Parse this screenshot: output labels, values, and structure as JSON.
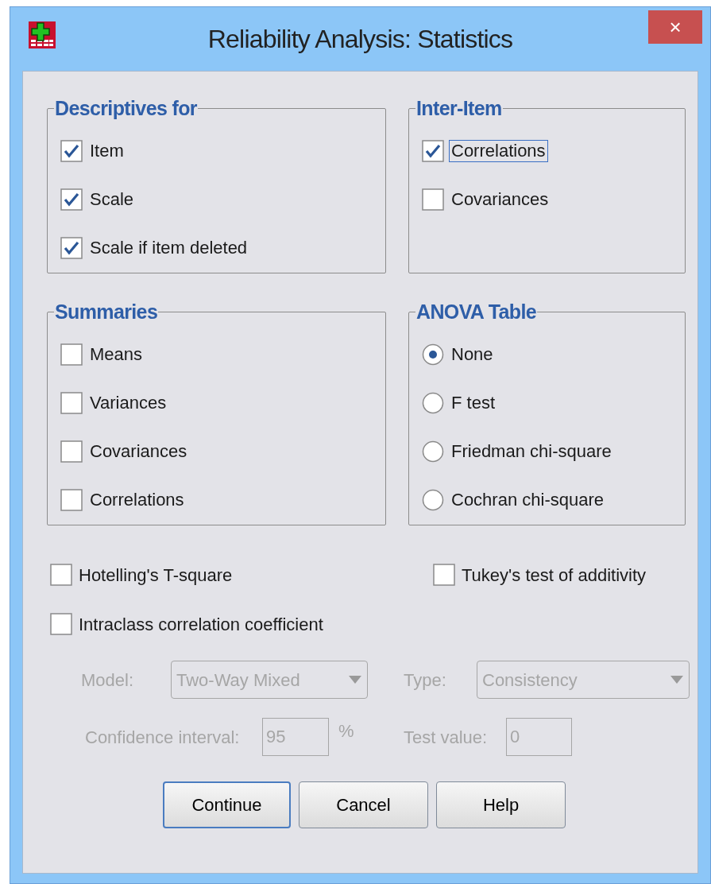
{
  "window": {
    "title": "Reliability Analysis: Statistics",
    "close": "×"
  },
  "groups": [
    {
      "kind": "checks",
      "title": "Descriptives for",
      "items": [
        {
          "label": "Item",
          "checked": true,
          "focused": false
        },
        {
          "label": "Scale",
          "checked": true,
          "focused": false
        },
        {
          "label": "Scale if item deleted",
          "checked": true,
          "focused": false
        }
      ]
    },
    {
      "kind": "checks",
      "title": "Inter-Item",
      "items": [
        {
          "label": "Correlations",
          "checked": true,
          "focused": true
        },
        {
          "label": "Covariances",
          "checked": false,
          "focused": false
        }
      ]
    },
    {
      "kind": "checks",
      "title": "Summaries",
      "items": [
        {
          "label": "Means",
          "checked": false,
          "focused": false
        },
        {
          "label": "Variances",
          "checked": false,
          "focused": false
        },
        {
          "label": "Covariances",
          "checked": false,
          "focused": false
        },
        {
          "label": "Correlations",
          "checked": false,
          "focused": false
        }
      ]
    },
    {
      "kind": "radios",
      "title": "ANOVA Table",
      "items": [
        {
          "label": "None",
          "selected": true
        },
        {
          "label": "F test",
          "selected": false
        },
        {
          "label": "Friedman chi-square",
          "selected": false
        },
        {
          "label": "Cochran chi-square",
          "selected": false
        }
      ]
    }
  ],
  "options": [
    {
      "label": "Hotelling's T-square",
      "checked": false
    },
    {
      "label": "Tukey's test of additivity",
      "checked": false
    },
    {
      "label": "Intraclass correlation coefficient",
      "checked": false
    }
  ],
  "icc_settings": {
    "disabled": true,
    "model": {
      "label": "Model:",
      "value": "Two-Way Mixed"
    },
    "type": {
      "label": "Type:",
      "value": "Consistency"
    },
    "confidence_interval": {
      "label": "Confidence interval:",
      "value": "95",
      "unit": "%"
    },
    "test_value": {
      "label": "Test value:",
      "value": "0"
    }
  },
  "buttons": [
    {
      "label": "Continue",
      "default": true
    },
    {
      "label": "Cancel",
      "default": false
    },
    {
      "label": "Help",
      "default": false
    }
  ]
}
